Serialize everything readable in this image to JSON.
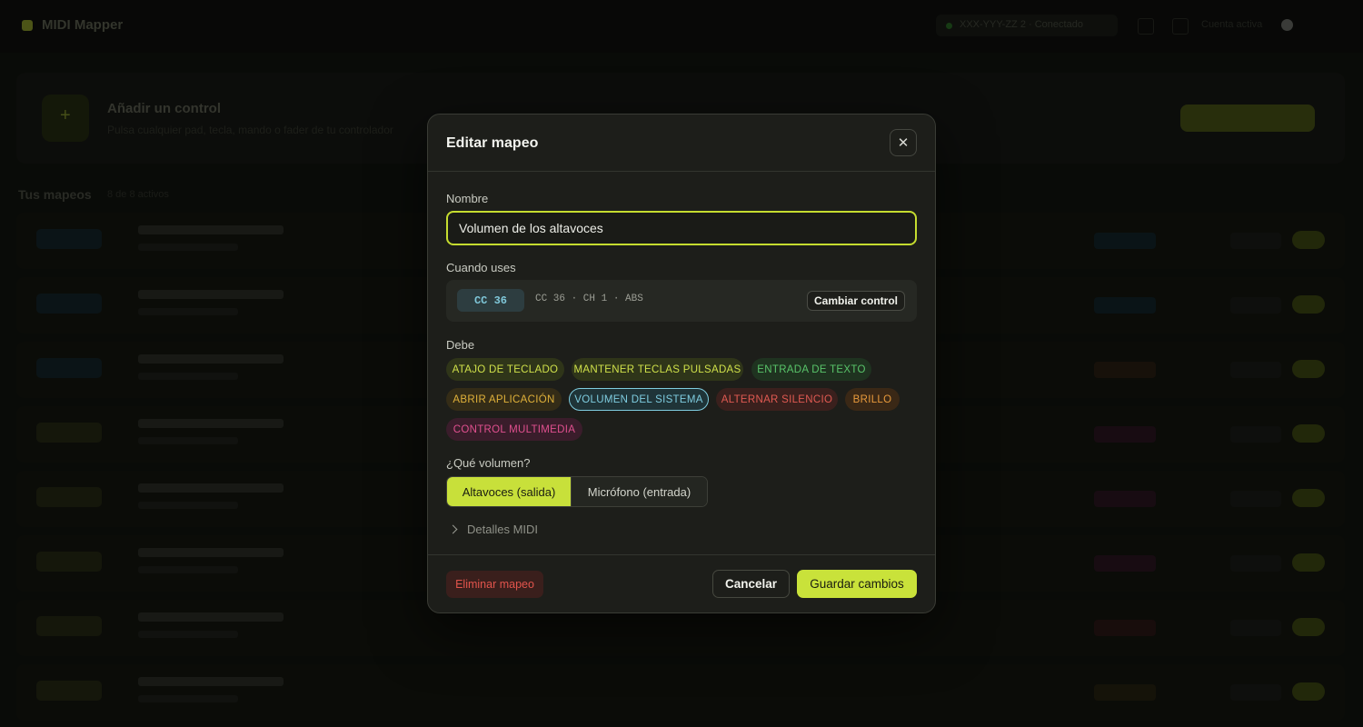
{
  "background": {
    "app_title": "MIDI Mapper",
    "device_label": "XXX-YYY-ZZ 2 · Conectado",
    "user_label": "Cuenta activa",
    "add_card": {
      "title": "Añadir un control",
      "subtitle": "Pulsa cualquier pad, tecla, mando o fader de tu controlador"
    },
    "list_title": "Tus mapeos",
    "list_count": "8 de 8 activos"
  },
  "modal": {
    "title": "Editar mapeo",
    "close_icon": "close-icon",
    "name_label": "Nombre",
    "name_value": "Volumen de los altavoces",
    "when_label": "Cuando uses",
    "control": {
      "pill": "CC 36",
      "detail": "CC 36 · CH 1 · ABS",
      "change_button": "Cambiar control"
    },
    "must_label": "Debe",
    "actions": [
      {
        "label": "ATAJO DE TECLADO",
        "color": "#cfe04a",
        "bg": "#2f3519",
        "selected": false
      },
      {
        "label": "MANTENER TECLAS PULSADAS",
        "color": "#cfe04a",
        "bg": "#2f3519",
        "selected": false
      },
      {
        "label": "ENTRADA DE TEXTO",
        "color": "#59c46a",
        "bg": "#1f3320",
        "selected": false
      },
      {
        "label": "ABRIR APLICACIÓN",
        "color": "#e0b13a",
        "bg": "#342c17",
        "selected": false
      },
      {
        "label": "VOLUMEN DEL SISTEMA",
        "color": "#7fcde0",
        "bg": "#1f3438",
        "selected": true
      },
      {
        "label": "ALTERNAR SILENCIO",
        "color": "#e05a52",
        "bg": "#3a201d",
        "selected": false
      },
      {
        "label": "BRILLO",
        "color": "#e89a3c",
        "bg": "#3a2816",
        "selected": false
      },
      {
        "label": "CONTROL MULTIMEDIA",
        "color": "#e0508f",
        "bg": "#3a1d2b",
        "selected": false
      }
    ],
    "volume_label": "¿Qué volumen?",
    "volume_options": [
      {
        "label": "Altavoces (salida)",
        "selected": true
      },
      {
        "label": "Micrófono (entrada)",
        "selected": false
      }
    ],
    "midi_details": "Detalles MIDI",
    "delete_button": "Eliminar mapeo",
    "cancel_button": "Cancelar",
    "save_button": "Guardar cambios"
  }
}
